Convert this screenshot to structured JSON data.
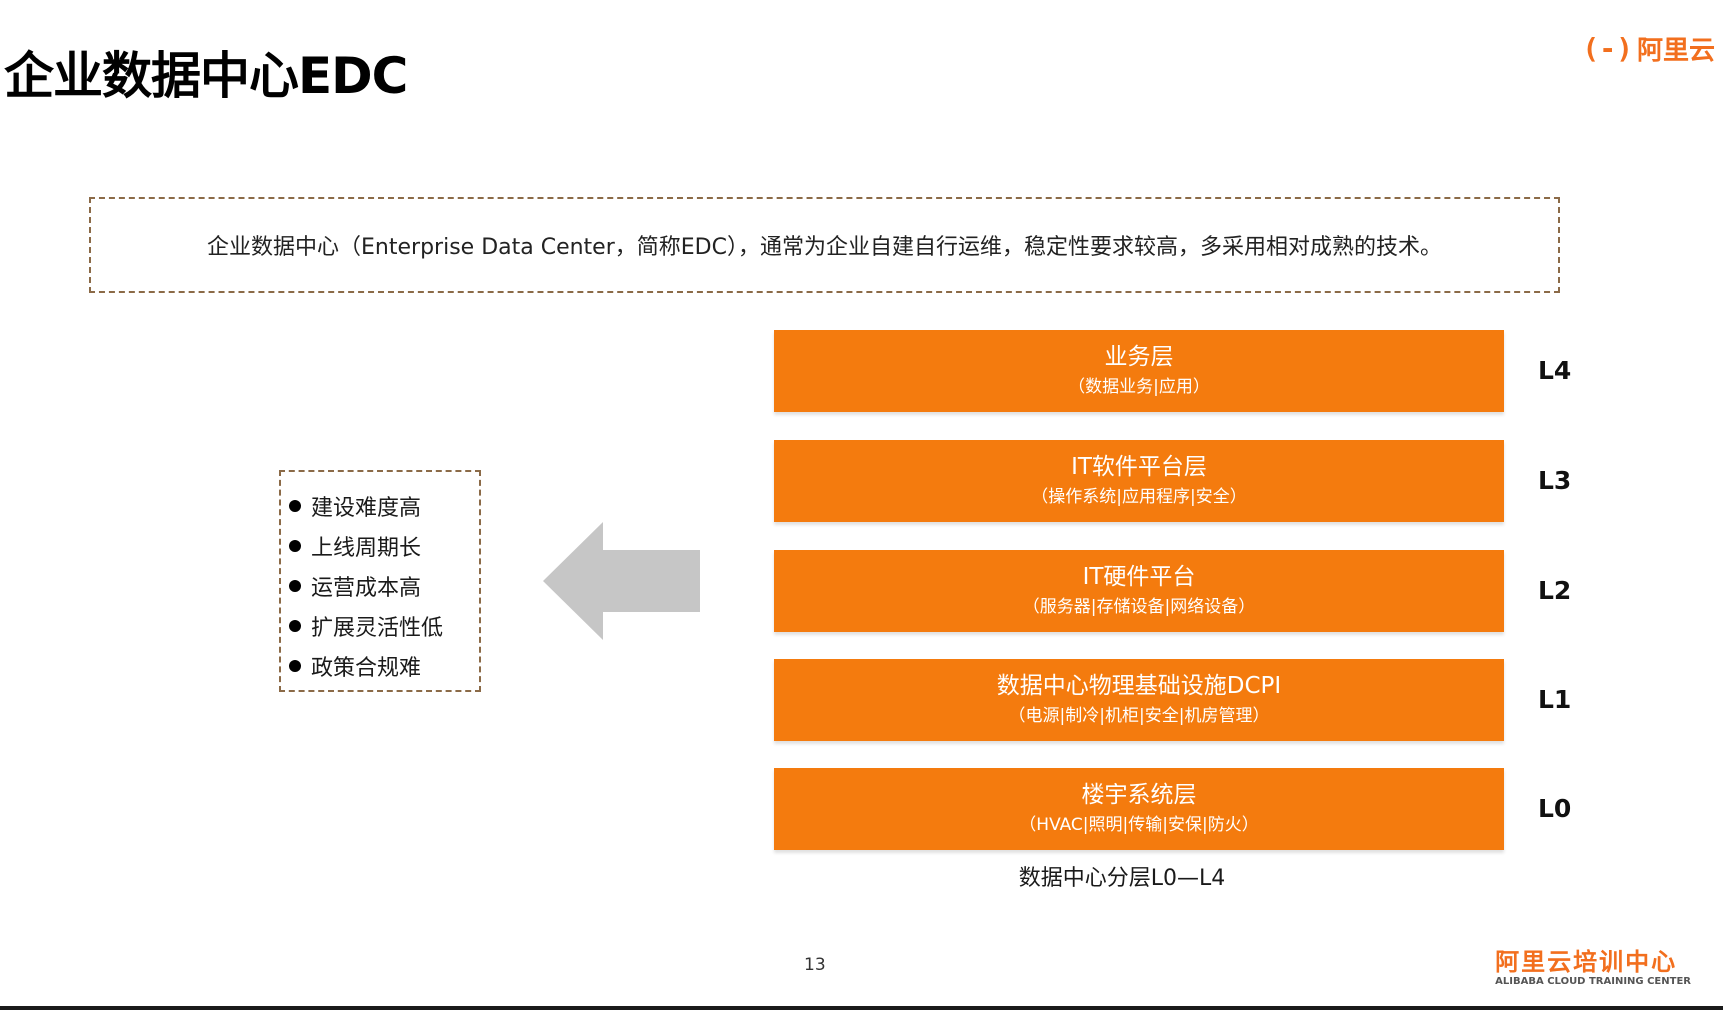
{
  "slide": {
    "title": "企业数据中心EDC",
    "page_number": "13"
  },
  "brand": {
    "logo_mark": "(-)",
    "logo_text": "阿里云",
    "footer_cn": "阿里云培训中心",
    "footer_en": "ALIBABA CLOUD TRAINING CENTER",
    "accent_color": "#f26f1e"
  },
  "definition": {
    "text": "企业数据中心（Enterprise Data Center，简称EDC），通常为企业自建自行运维，稳定性要求较高，多采用相对成熟的技术。"
  },
  "cons": {
    "items": [
      "建设难度高",
      "上线周期长",
      "运营成本高",
      "扩展灵活性低",
      "政策合规难"
    ]
  },
  "arrow": {
    "icon": "left-arrow-icon",
    "color": "#c6c6c6"
  },
  "layers": {
    "color": "#f47b0e",
    "items": [
      {
        "level": "L4",
        "name": "业务层",
        "detail": "（数据业务|应用）"
      },
      {
        "level": "L3",
        "name": "IT软件平台层",
        "detail": "（操作系统|应用程序|安全）"
      },
      {
        "level": "L2",
        "name": "IT硬件平台",
        "detail": "（服务器|存储设备|网络设备）"
      },
      {
        "level": "L1",
        "name": "数据中心物理基础设施DCPI",
        "detail": "（电源|制冷|机柜|安全|机房管理）"
      },
      {
        "level": "L0",
        "name": "楼宇系统层",
        "detail": "（HVAC|照明|传输|安保|防火）"
      }
    ],
    "caption": "数据中心分层L0—L4"
  }
}
